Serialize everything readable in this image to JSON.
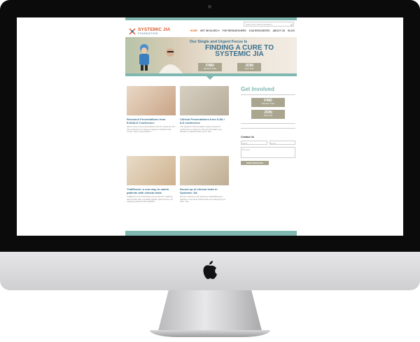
{
  "search": {
    "placeholder": "Search the SJIA Foundation..."
  },
  "logo": {
    "line1": "SYSTEMIC JIA",
    "line2": "FOUNDATION"
  },
  "nav": [
    "HOME",
    "GET INVOLVED ▾",
    "FOR RESEARCHERS",
    "SJIA RESOURCES",
    "ABOUT US",
    "BLOG"
  ],
  "hero": {
    "subhead": "Our Single and Urgent Focus Is",
    "headline_1": "FINDING A CURE TO",
    "headline_2": "SYSTEMIC JIA",
    "find": {
      "label": "FIND",
      "sub": "Research Trials"
    },
    "join": {
      "label": "JOIN",
      "sub": "Team SJIA"
    }
  },
  "cards": [
    {
      "title": "Research Presentations from EJIA/ILD Conference",
      "text": "Here's some more presentations from the Systemic JIA / ILD conference we helped organize at Stanford this month. These presentations..."
    },
    {
      "title": "Clinical Presentations from SJIA / ILD conference",
      "text": "The Systemic JIA Foundation helped support a conference on Systemic JIA and Interstitial Lung Disease at Stanford last month. Dur..."
    },
    {
      "title": "TrialReach: a new way to match patients with clinical trials",
      "text": "TrialReach is an interesting new service for matching clinical trials with potentially eligible. Each service, for matching patients with available..."
    },
    {
      "title": "Round up of clinical trials in Systemic JIA",
      "text": "We are a check on the awesome clinicaltrials.gov website to see what clinical trials were happening for SJIA. The..."
    }
  ],
  "sidebar": {
    "title": "Get Involved",
    "find": {
      "label": "FIND",
      "sub": "Research Trials"
    },
    "join": {
      "label": "JOIN",
      "sub": "Team SJIA"
    },
    "contact_title": "Contact Us",
    "name_placeholder": "Name",
    "email_placeholder": "Email",
    "message_placeholder": "Message",
    "send_label": "SEND MESSAGE"
  },
  "colors": {
    "accent": "#7fb7b1",
    "brand_orange": "#d9582b",
    "brand_blue": "#3a6f8e",
    "button": "#a9a58f"
  }
}
